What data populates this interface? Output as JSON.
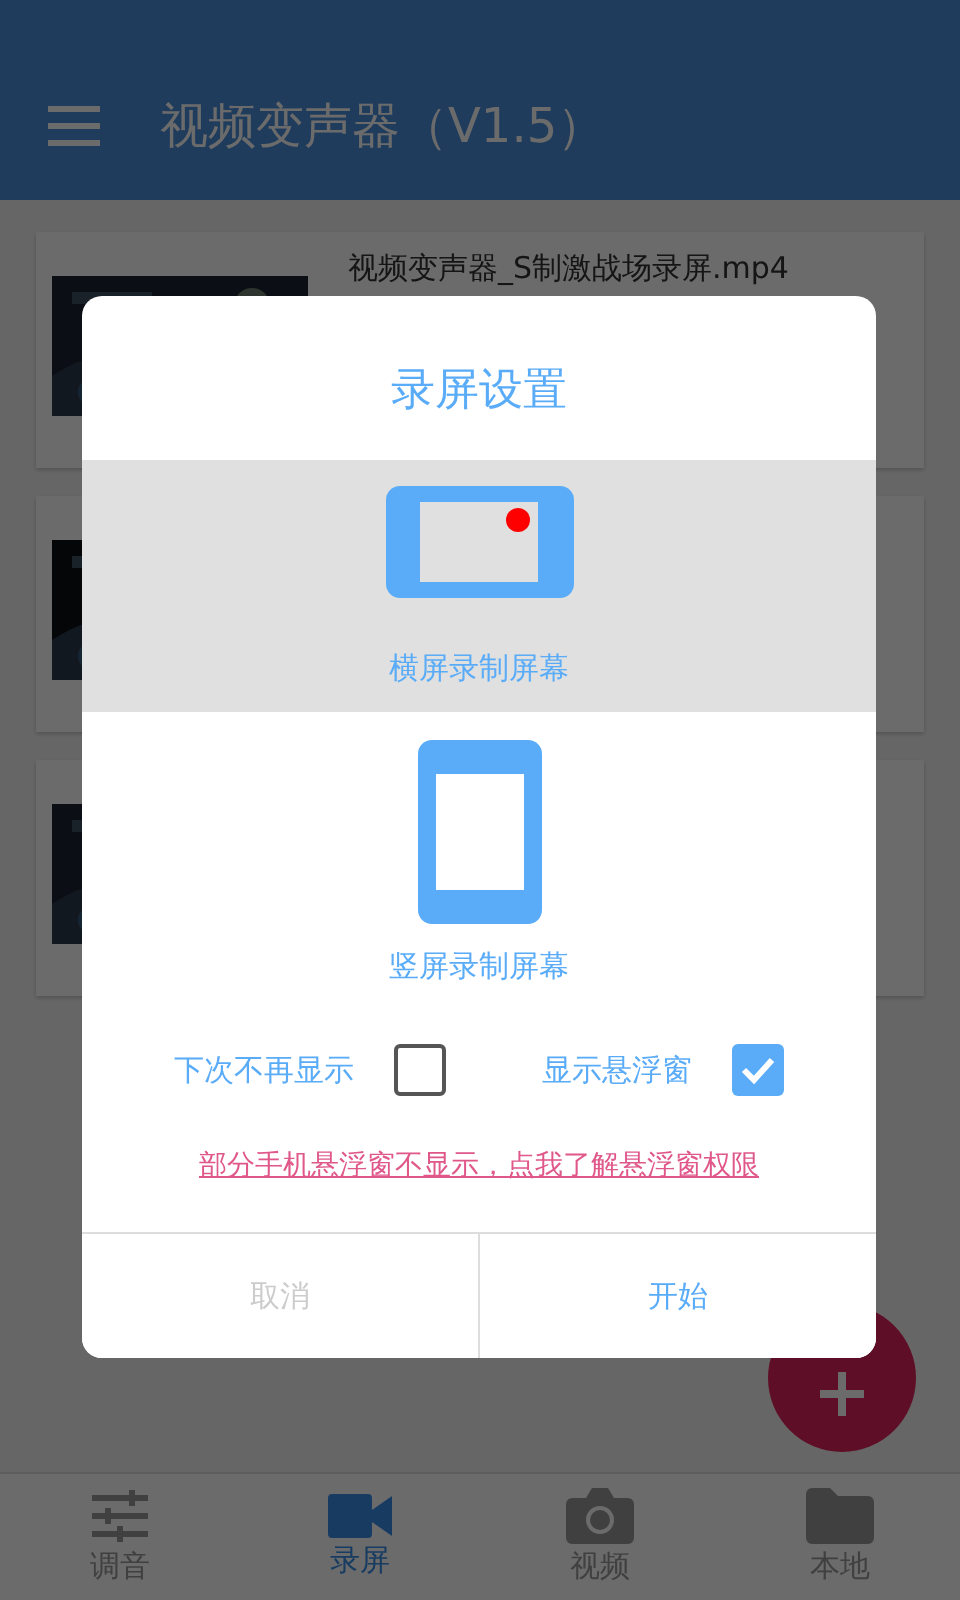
{
  "app_bar": {
    "title": "视频变声器（V1.5）"
  },
  "videos": [
    {
      "kind": "picture",
      "title": "视频变声器_S制激战场录屏.mp4"
    },
    {
      "kind": "picture"
    },
    {
      "kind": "picture"
    }
  ],
  "dialog": {
    "title": "录屏设置",
    "options": [
      {
        "kind": "landscape",
        "label": "横屏录制屏幕",
        "selected": true
      },
      {
        "kind": "portrait",
        "label": "竖屏录制屏幕",
        "selected": false
      }
    ],
    "checkboxes": [
      {
        "label": "下次不再显示",
        "checked": false
      },
      {
        "label": "显示悬浮窗",
        "checked": true
      }
    ],
    "link": "部分手机悬浮窗不显示，点我了解悬浮窗权限",
    "buttons": [
      {
        "label": "取消",
        "disabled": true
      },
      {
        "label": "开始",
        "disabled": false
      }
    ]
  },
  "bottom_nav": [
    {
      "kind": "sliders",
      "label": "调音",
      "selected": false
    },
    {
      "kind": "camcorder",
      "label": "录屏",
      "selected": true
    },
    {
      "kind": "camera",
      "label": "视频",
      "selected": false
    },
    {
      "kind": "folder",
      "label": "本地",
      "selected": false
    }
  ]
}
